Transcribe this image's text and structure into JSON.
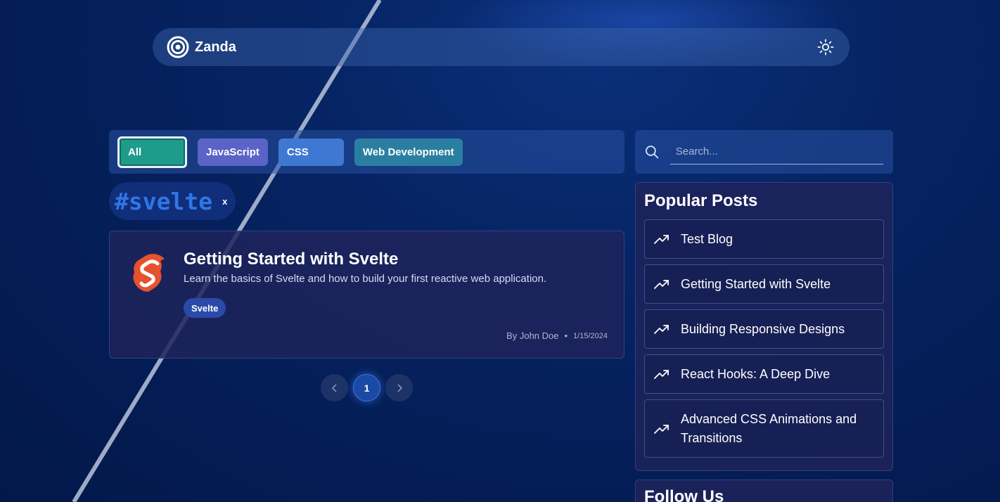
{
  "brand": {
    "name": "Zanda"
  },
  "header": {
    "theme_toggle": "sun-icon"
  },
  "filters": {
    "items": [
      "All",
      "JavaScript",
      "CSS",
      "Web Development"
    ],
    "selected": "All"
  },
  "active_tag": {
    "label": "#svelte",
    "clear": "x"
  },
  "posts": [
    {
      "title": "Getting Started with Svelte",
      "description": "Learn the basics of Svelte and how to build your first reactive web application.",
      "tag": "Svelte",
      "author": "By John Doe",
      "separator": "•",
      "date": "1/15/2024"
    }
  ],
  "pagination": {
    "current": "1",
    "prev_icon": "chevron-left-icon",
    "next_icon": "chevron-right-icon"
  },
  "search": {
    "placeholder": "Search..."
  },
  "popular": {
    "title": "Popular Posts",
    "items": [
      "Test Blog",
      "Getting Started with Svelte",
      "Building Responsive Designs",
      "React Hooks: A Deep Dive",
      "Advanced CSS Animations and Transitions"
    ]
  },
  "follow": {
    "title": "Follow Us"
  },
  "colors": {
    "background": "#041d55",
    "accent_all": "#1f9b8c",
    "chip_javascript": "#5b63c7",
    "chip_css": "#3f78d2",
    "chip_web": "#2a7fa0",
    "tag_highlight": "#2f76e6"
  }
}
